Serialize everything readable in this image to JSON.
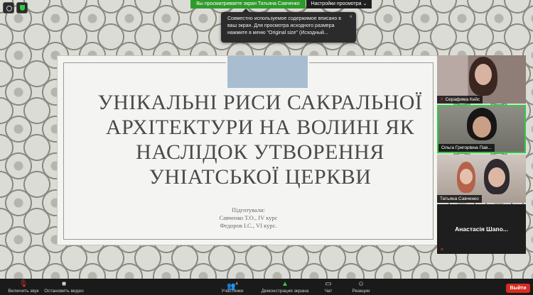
{
  "top_bar": {
    "viewing_banner": "Вы просматриваете экран Татьяна Савченко",
    "view_options": "Настройки просмотра ⌄"
  },
  "tooltip": {
    "text": "Совместно используемое содержимое вписано в ваш экран. Для просмотра исходного размера нажмите в меню \"Original size\" (Исходный...",
    "close": "×"
  },
  "slide": {
    "title": "Унікальні риси сакральної\nархітектури на Волині як\nнаслідок утворення\nуніатської церкви",
    "prepared_by": "Підготували:",
    "authors": [
      "Савченко Т.О., IV курс",
      "Федоров І.С., VI курс."
    ]
  },
  "participants": [
    {
      "name": "Серафима Кейс",
      "muted": true
    },
    {
      "name": "Ольга Григорівна Пав...",
      "muted": false,
      "active_speaker": true
    },
    {
      "name": "Татьяна Савченко",
      "muted": false
    },
    {
      "name": "Анастасія Шапо...",
      "muted": true,
      "video_off": true
    }
  ],
  "toolbar": {
    "mute_label": "Включить звук",
    "video_label": "Остановить видео",
    "participants_label": "Участники",
    "participants_count": "4",
    "share_label": "Демонстрация экрана",
    "chat_label": "Чат",
    "reactions_label": "Реакции",
    "leave_label": "Выйти"
  },
  "colors": {
    "banner_green": "#2e9a2b",
    "leave_red": "#d62d20",
    "speaker_outline": "#2ecc40",
    "slide_accent": "#a9bdd1"
  },
  "icons": {
    "view": "view-icon",
    "security": "shield-icon",
    "mic_off": "mic-off-icon",
    "video": "video-icon",
    "participants": "participants-icon",
    "share": "share-screen-icon",
    "chat": "chat-icon",
    "reactions": "reactions-icon"
  }
}
